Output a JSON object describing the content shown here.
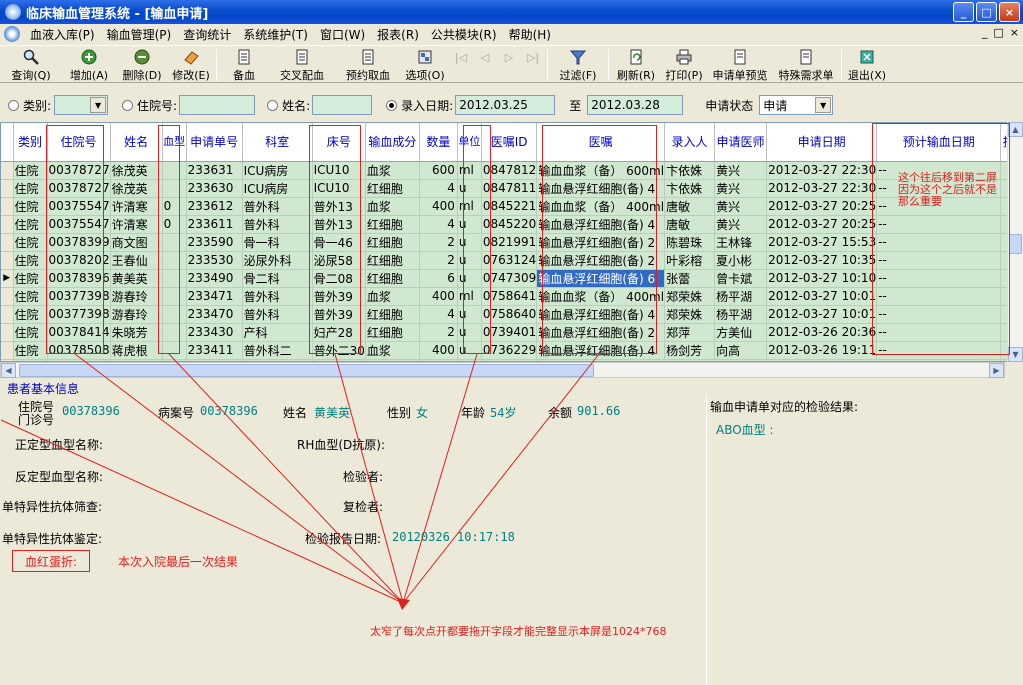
{
  "window": {
    "title": "临床输血管理系统 - [输血申请]",
    "buttons": [
      "_",
      "□",
      "×"
    ]
  },
  "menu": {
    "items": [
      "血液入库(P)",
      "输血管理(P)",
      "查询统计",
      "系统维护(T)",
      "窗口(W)",
      "报表(R)",
      "公共模块(R)",
      "帮助(H)"
    ],
    "mdi": [
      "_",
      "□",
      "×"
    ]
  },
  "toolbar": {
    "query": "查询(Q)",
    "add": "增加(A)",
    "delete": "删除(D)",
    "edit": "修改(E)",
    "reserve": "备血",
    "crossmatch": "交叉配血",
    "pre_take": "预约取血",
    "options": "选项(O)",
    "filter": "过滤(F)",
    "refresh": "刷新(R)",
    "print": "打印(P)",
    "preview": "申请单预览",
    "special": "特殊需求单",
    "exit": "退出(X)"
  },
  "filter": {
    "type_label": "类别:",
    "type_value": "",
    "inpatient_label": "住院号:",
    "inpatient_value": "",
    "name_label": "姓名:",
    "name_value": "",
    "date_label": "录入日期:",
    "date_from": "2012.03.25",
    "to_label": "至",
    "date_to": "2012.03.28",
    "status_label": "申请状态",
    "status_value": "申请"
  },
  "table": {
    "headers": [
      "类别",
      "住院号",
      "姓名",
      "血型",
      "申请单号",
      "科室",
      "床号",
      "输血成分",
      "数量",
      "单位",
      "医嘱ID",
      "医嘱",
      "录入人",
      "申请医师",
      "申请日期",
      "预计输血日期",
      "拍"
    ],
    "rows": [
      [
        "住院",
        "00378727",
        "徐茂英",
        "",
        "233631",
        "ICU病房",
        "ICU10",
        "血浆",
        "600",
        "ml",
        "0847812",
        "输血血浆（备） 600ml",
        "卞依姝",
        "黄兴",
        "2012-03-27 22:30",
        "--",
        ""
      ],
      [
        "住院",
        "00378727",
        "徐茂英",
        "",
        "233630",
        "ICU病房",
        "ICU10",
        "红细胞",
        "4",
        "u",
        "0847811",
        "输血悬浮红细胞(备) 4",
        "卞依姝",
        "黄兴",
        "2012-03-27 22:30",
        "--",
        ""
      ],
      [
        "住院",
        "00375547",
        "许清寒",
        "0",
        "233612",
        "普外科",
        "普外13",
        "血浆",
        "400",
        "ml",
        "0845221",
        "输血血浆（备） 400ml",
        "唐敏",
        "黄兴",
        "2012-03-27 20:25",
        "--",
        ""
      ],
      [
        "住院",
        "00375547",
        "许清寒",
        "0",
        "233611",
        "普外科",
        "普外13",
        "红细胞",
        "4",
        "u",
        "0845220",
        "输血悬浮红细胞(备) 4",
        "唐敏",
        "黄兴",
        "2012-03-27 20:25",
        "--",
        ""
      ],
      [
        "住院",
        "00378399",
        "商文图",
        "",
        "233590",
        "骨一科",
        "骨一46",
        "红细胞",
        "2",
        "u",
        "0821991",
        "输血悬浮红细胞(备) 2",
        "陈碧珠",
        "王林锋",
        "2012-03-27 15:53",
        "--",
        ""
      ],
      [
        "住院",
        "00378202",
        "王春仙",
        "",
        "233530",
        "泌尿外科",
        "泌尿58",
        "红细胞",
        "2",
        "u",
        "0763124",
        "输血悬浮红细胞(备) 2",
        "叶彩榕",
        "夏小彬",
        "2012-03-27 10:35",
        "--",
        ""
      ],
      [
        "住院",
        "00378396",
        "黄美英",
        "",
        "233490",
        "骨二科",
        "骨二08",
        "红细胞",
        "6",
        "u",
        "0747309",
        "输血悬浮红细胞(备) 6",
        "张蕾",
        "曾卡斌",
        "2012-03-27 10:10",
        "--",
        ""
      ],
      [
        "住院",
        "00377398",
        "游春玲",
        "",
        "233471",
        "普外科",
        "普外39",
        "血浆",
        "400",
        "ml",
        "0758641",
        "输血血浆（备） 400ml",
        "郑荣姝",
        "杨平湖",
        "2012-03-27 10:01",
        "--",
        ""
      ],
      [
        "住院",
        "00377398",
        "游春玲",
        "",
        "233470",
        "普外科",
        "普外39",
        "红细胞",
        "4",
        "u",
        "0758640",
        "输血悬浮红细胞(备) 4",
        "郑荣姝",
        "杨平湖",
        "2012-03-27 10:01",
        "--",
        ""
      ],
      [
        "住院",
        "00378414",
        "朱晓芳",
        "",
        "233430",
        "产科",
        "妇产28",
        "红细胞",
        "2",
        "u",
        "0739401",
        "输血悬浮红细胞(备) 2",
        "郑萍",
        "方美仙",
        "2012-03-26 20:36",
        "--",
        ""
      ],
      [
        "住院",
        "00378508",
        "蒋虎根",
        "",
        "233411",
        "普外科二",
        "普外二30",
        "血浆",
        "400",
        "u",
        "0736229",
        "输血悬浮红细胞(备) 4",
        "杨剑芳",
        "向高",
        "2012-03-26 19:11",
        "--",
        ""
      ],
      [
        "住院",
        "00378508",
        "蒋虎根",
        "",
        "233410",
        "普外科二",
        "普外二30",
        "红细胞",
        "4",
        "u",
        "0736228",
        "输血悬浮红细胞(备) 4",
        "杨剑芳",
        "向高",
        "2012-03-26 19:11",
        "--",
        ""
      ]
    ]
  },
  "patient": {
    "section_title": "患者基本信息",
    "inpatient_label": "住院号",
    "outpatient_label": "门诊号",
    "inpatient_no": "00378396",
    "case_label": "病案号",
    "case_no": "00378396",
    "name_label": "姓名",
    "name": "黄美英",
    "sex_label": "性别",
    "sex": "女",
    "age_label": "年龄",
    "age": "54岁",
    "balance_label": "余额",
    "balance": "901.66",
    "abo_forward_label": "正定型血型名称:",
    "rh_label": "RH血型(D抗原):",
    "abo_reverse_label": "反定型血型名称:",
    "tester_label": "检验者:",
    "antibody_screen_label": "单特异性抗体筛查:",
    "rechecker_label": "复检者:",
    "antibody_id_label": "单特异性抗体鉴定:",
    "report_date_label": "检验报告日期:",
    "report_date": "20120326 10:17:18",
    "hb_label": "血红蛋折:"
  },
  "results": {
    "title": "输血申请单对应的检验结果:",
    "abo_label": "ABO血型 :"
  },
  "annotations": {
    "hb_note": "本次入院最后一次结果",
    "right_note_1": "这个往后移到第二屏",
    "right_note_2": "因为这个之后就不是",
    "right_note_3": "那么重要",
    "bottom_note": "太窄了每次点开都要拖开字段才能完整显示本屏是1024*768"
  },
  "colors": {
    "title_bar": "#0A4ECF",
    "row_bg": "#CFE8CF",
    "selected": "#316AC5",
    "annotation": "#E02020",
    "header_text": "#0000CC"
  }
}
